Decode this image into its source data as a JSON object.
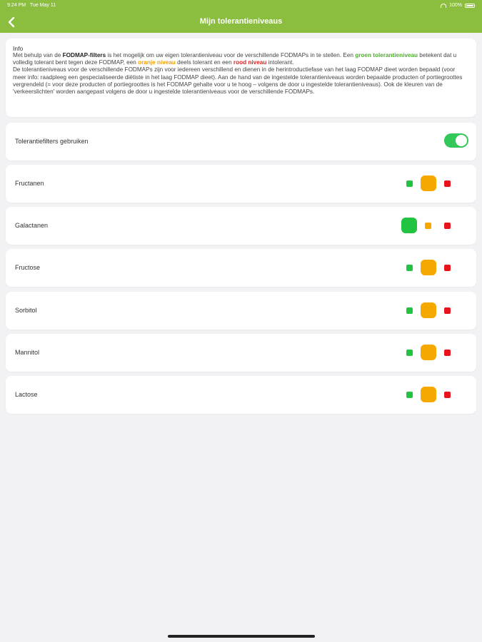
{
  "status_bar": {
    "time": "9:24 PM",
    "date": "Tue May 11",
    "battery": "100%"
  },
  "nav": {
    "title": "Mijn tolerantieniveaus",
    "back_icon": "chevron-left-icon"
  },
  "info": {
    "title": "Info",
    "p1": "Met behulp van de ",
    "p1_bold": "FODMAP-filters",
    "p2": " is het mogelijk om uw eigen tolerantieniveau voor de verschillende FODMAPs in te stellen. Een ",
    "green_level": "groen tolerantieniveau",
    "p3": " betekent dat u volledig tolerant bent tegen deze FODMAP, een ",
    "orange_level": "oranje niveau",
    "p4": " deels tolerant en een ",
    "red_level": "rood niveau",
    "p5": " intolerant.",
    "p6": "De tolerantieniveaus voor de verschillende FODMAPs zijn voor iedereen verschillend en dienen in de herintroductiefase van het laag FODMAP dieet worden bepaald (voor meer info: raadpleeg een gespecialiseerde diëtiste in het laag FODMAP dieet). Aan de hand van de ingestelde tolerantieniveaus worden bepaalde producten of portiegroottes vergrendeld (= voor deze producten of portiegroottes is het FODMAP gehalte voor u te hoog – volgens de door u ingestelde tolerantieniveaus). Ook de kleuren van de 'verkeerslichten' worden aangepast volgens de door u ingestelde tolerantieniveaus voor de verschillende FODMAPs."
  },
  "toggle_row": {
    "label": "Tolerantiefilters gebruiken",
    "enabled": true
  },
  "colors": {
    "accent": "#8bbd3f",
    "green": "#22c340",
    "orange": "#f5a800",
    "red": "#e8141c",
    "toggle_on": "#34c759"
  },
  "fodmaps": [
    {
      "label": "Fructanen",
      "selected": "orange"
    },
    {
      "label": "Galactanen",
      "selected": "green"
    },
    {
      "label": "Fructose",
      "selected": "orange"
    },
    {
      "label": "Sorbitol",
      "selected": "orange"
    },
    {
      "label": "Mannitol",
      "selected": "orange"
    },
    {
      "label": "Lactose",
      "selected": "orange"
    }
  ]
}
